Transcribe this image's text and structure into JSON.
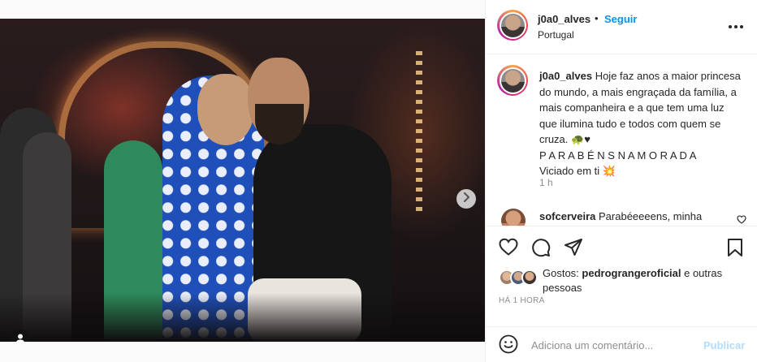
{
  "post": {
    "photo": {
      "alt": "",
      "carousel": {
        "total": 2,
        "current": 1
      },
      "next_icon": "chevron-right-icon",
      "tag_icon": "user-tag-icon"
    },
    "header": {
      "username": "j0a0_alves",
      "separator": "•",
      "follow_label": "Seguir",
      "location": "Portugal",
      "more_icon": "more-horizontal-icon"
    },
    "caption": {
      "username": "j0a0_alves",
      "text": " Hoje faz anos a maior princesa do mundo, a mais engraçada da família, a mais companheira e a que tem uma luz que ilumina tudo e todos com quem se cruza. 🐢♥",
      "line2": "P A R A B É N S N A M O R A D A",
      "line3": "Viciado em ti 💥",
      "time": "1 h"
    },
    "comments": [
      {
        "username": "sofcerveira",
        "text": " Parabéeeeens, minha"
      }
    ],
    "actions": {
      "like_icon": "heart-icon",
      "comment_icon": "comment-icon",
      "share_icon": "share-icon",
      "save_icon": "bookmark-icon"
    },
    "likes": {
      "prefix": "Gostos: ",
      "user": "pedrograngeroficial",
      "suffix": " e outras pessoas"
    },
    "time_ago": "HÁ 1 HORA",
    "composer": {
      "emoji_icon": "emoji-icon",
      "placeholder": "Adiciona um comentário...",
      "publish_label": "Publicar"
    },
    "colors": {
      "link": "#0095f6",
      "publish_disabled": "#b3dbff",
      "muted": "#8e8e8e",
      "text": "#262626"
    }
  }
}
